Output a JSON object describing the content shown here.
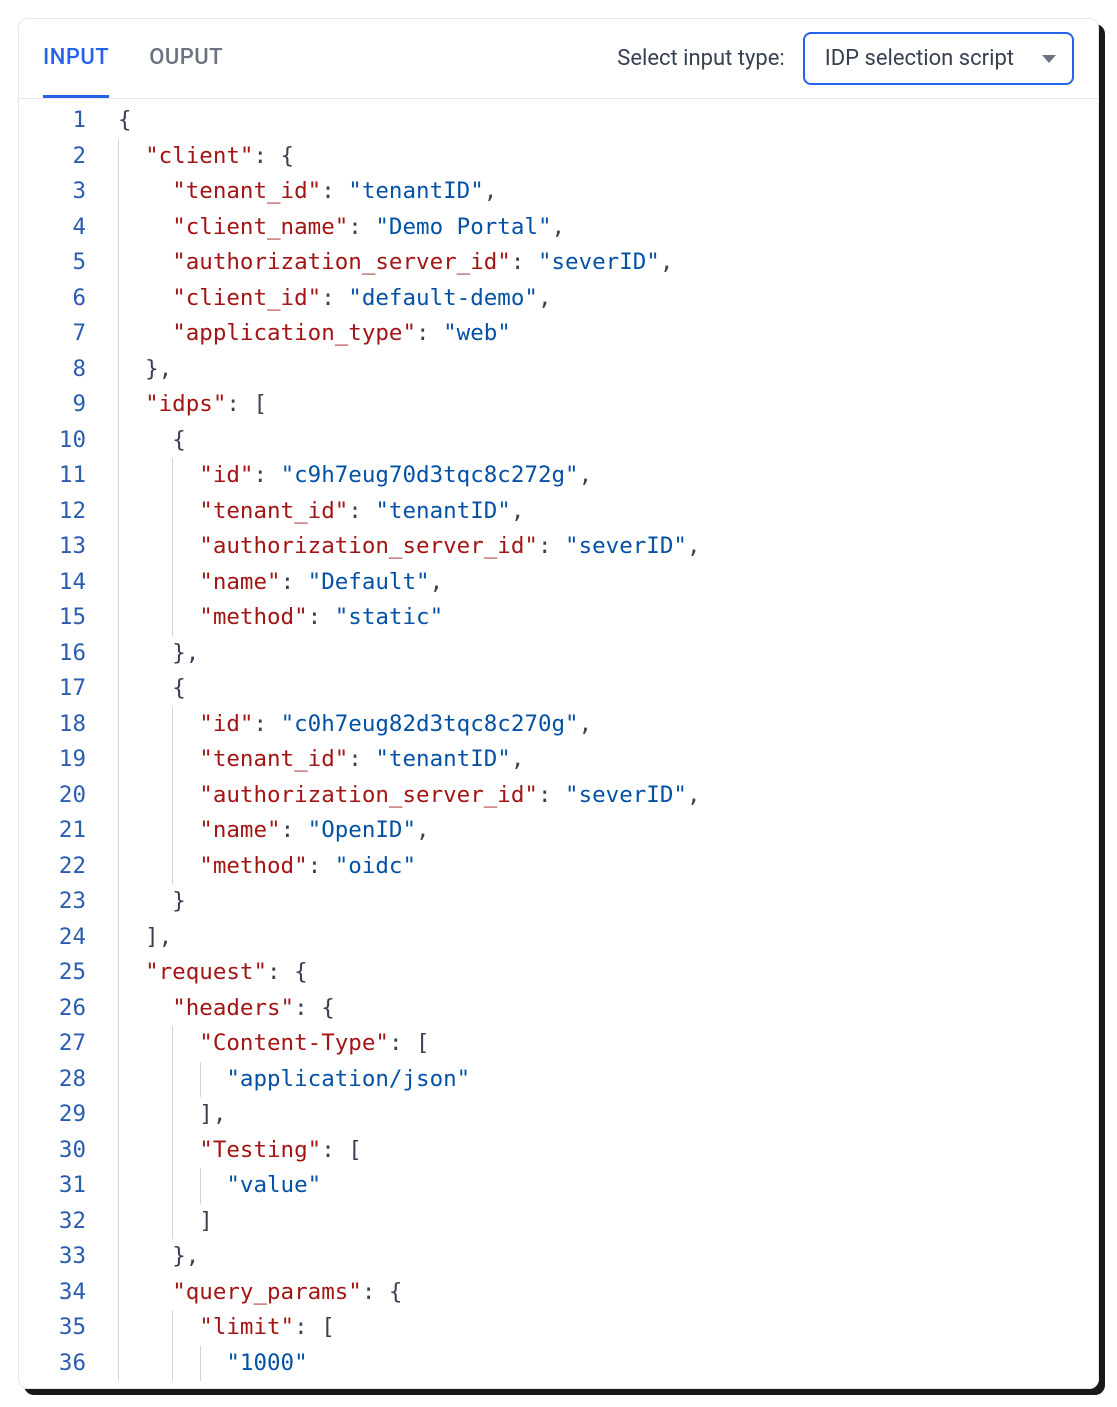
{
  "tabs": {
    "input": "INPUT",
    "output": "OUPUT"
  },
  "select": {
    "label": "Select input type:",
    "value": "IDP selection script"
  },
  "code_lines": [
    {
      "n": 1,
      "guides": [],
      "indent": "",
      "tokens": [
        [
          "p",
          "{"
        ]
      ]
    },
    {
      "n": 2,
      "guides": [
        0
      ],
      "indent": "  ",
      "tokens": [
        [
          "k",
          "\"client\""
        ],
        [
          "p",
          ": {"
        ]
      ]
    },
    {
      "n": 3,
      "guides": [
        0
      ],
      "indent": "    ",
      "tokens": [
        [
          "k",
          "\"tenant_id\""
        ],
        [
          "p",
          ": "
        ],
        [
          "s",
          "\"tenantID\""
        ],
        [
          "p",
          ","
        ]
      ]
    },
    {
      "n": 4,
      "guides": [
        0
      ],
      "indent": "    ",
      "tokens": [
        [
          "k",
          "\"client_name\""
        ],
        [
          "p",
          ": "
        ],
        [
          "s",
          "\"Demo Portal\""
        ],
        [
          "p",
          ","
        ]
      ]
    },
    {
      "n": 5,
      "guides": [
        0
      ],
      "indent": "    ",
      "tokens": [
        [
          "k",
          "\"authorization_server_id\""
        ],
        [
          "p",
          ": "
        ],
        [
          "s",
          "\"severID\""
        ],
        [
          "p",
          ","
        ]
      ]
    },
    {
      "n": 6,
      "guides": [
        0
      ],
      "indent": "    ",
      "tokens": [
        [
          "k",
          "\"client_id\""
        ],
        [
          "p",
          ": "
        ],
        [
          "s",
          "\"default-demo\""
        ],
        [
          "p",
          ","
        ]
      ]
    },
    {
      "n": 7,
      "guides": [
        0
      ],
      "indent": "    ",
      "tokens": [
        [
          "k",
          "\"application_type\""
        ],
        [
          "p",
          ": "
        ],
        [
          "s",
          "\"web\""
        ]
      ]
    },
    {
      "n": 8,
      "guides": [
        0
      ],
      "indent": "  ",
      "tokens": [
        [
          "p",
          "},"
        ]
      ]
    },
    {
      "n": 9,
      "guides": [
        0
      ],
      "indent": "  ",
      "tokens": [
        [
          "k",
          "\"idps\""
        ],
        [
          "p",
          ": ["
        ]
      ]
    },
    {
      "n": 10,
      "guides": [
        0
      ],
      "indent": "    ",
      "tokens": [
        [
          "p",
          "{"
        ]
      ]
    },
    {
      "n": 11,
      "guides": [
        0,
        4
      ],
      "indent": "      ",
      "tokens": [
        [
          "k",
          "\"id\""
        ],
        [
          "p",
          ": "
        ],
        [
          "s",
          "\"c9h7eug70d3tqc8c272g\""
        ],
        [
          "p",
          ","
        ]
      ]
    },
    {
      "n": 12,
      "guides": [
        0,
        4
      ],
      "indent": "      ",
      "tokens": [
        [
          "k",
          "\"tenant_id\""
        ],
        [
          "p",
          ": "
        ],
        [
          "s",
          "\"tenantID\""
        ],
        [
          "p",
          ","
        ]
      ]
    },
    {
      "n": 13,
      "guides": [
        0,
        4
      ],
      "indent": "      ",
      "tokens": [
        [
          "k",
          "\"authorization_server_id\""
        ],
        [
          "p",
          ": "
        ],
        [
          "s",
          "\"severID\""
        ],
        [
          "p",
          ","
        ]
      ]
    },
    {
      "n": 14,
      "guides": [
        0,
        4
      ],
      "indent": "      ",
      "tokens": [
        [
          "k",
          "\"name\""
        ],
        [
          "p",
          ": "
        ],
        [
          "s",
          "\"Default\""
        ],
        [
          "p",
          ","
        ]
      ]
    },
    {
      "n": 15,
      "guides": [
        0,
        4
      ],
      "indent": "      ",
      "tokens": [
        [
          "k",
          "\"method\""
        ],
        [
          "p",
          ": "
        ],
        [
          "s",
          "\"static\""
        ]
      ]
    },
    {
      "n": 16,
      "guides": [
        0
      ],
      "indent": "    ",
      "tokens": [
        [
          "p",
          "},"
        ]
      ]
    },
    {
      "n": 17,
      "guides": [
        0
      ],
      "indent": "    ",
      "tokens": [
        [
          "p",
          "{"
        ]
      ]
    },
    {
      "n": 18,
      "guides": [
        0,
        4
      ],
      "indent": "      ",
      "tokens": [
        [
          "k",
          "\"id\""
        ],
        [
          "p",
          ": "
        ],
        [
          "s",
          "\"c0h7eug82d3tqc8c270g\""
        ],
        [
          "p",
          ","
        ]
      ]
    },
    {
      "n": 19,
      "guides": [
        0,
        4
      ],
      "indent": "      ",
      "tokens": [
        [
          "k",
          "\"tenant_id\""
        ],
        [
          "p",
          ": "
        ],
        [
          "s",
          "\"tenantID\""
        ],
        [
          "p",
          ","
        ]
      ]
    },
    {
      "n": 20,
      "guides": [
        0,
        4
      ],
      "indent": "      ",
      "tokens": [
        [
          "k",
          "\"authorization_server_id\""
        ],
        [
          "p",
          ": "
        ],
        [
          "s",
          "\"severID\""
        ],
        [
          "p",
          ","
        ]
      ]
    },
    {
      "n": 21,
      "guides": [
        0,
        4
      ],
      "indent": "      ",
      "tokens": [
        [
          "k",
          "\"name\""
        ],
        [
          "p",
          ": "
        ],
        [
          "s",
          "\"OpenID\""
        ],
        [
          "p",
          ","
        ]
      ]
    },
    {
      "n": 22,
      "guides": [
        0,
        4
      ],
      "indent": "      ",
      "tokens": [
        [
          "k",
          "\"method\""
        ],
        [
          "p",
          ": "
        ],
        [
          "s",
          "\"oidc\""
        ]
      ]
    },
    {
      "n": 23,
      "guides": [
        0
      ],
      "indent": "    ",
      "tokens": [
        [
          "p",
          "}"
        ]
      ]
    },
    {
      "n": 24,
      "guides": [
        0
      ],
      "indent": "  ",
      "tokens": [
        [
          "p",
          "],"
        ]
      ]
    },
    {
      "n": 25,
      "guides": [
        0
      ],
      "indent": "  ",
      "tokens": [
        [
          "k",
          "\"request\""
        ],
        [
          "p",
          ": {"
        ]
      ]
    },
    {
      "n": 26,
      "guides": [
        0
      ],
      "indent": "    ",
      "tokens": [
        [
          "k",
          "\"headers\""
        ],
        [
          "p",
          ": {"
        ]
      ]
    },
    {
      "n": 27,
      "guides": [
        0,
        4
      ],
      "indent": "      ",
      "tokens": [
        [
          "k",
          "\"Content-Type\""
        ],
        [
          "p",
          ": ["
        ]
      ]
    },
    {
      "n": 28,
      "guides": [
        0,
        4,
        6
      ],
      "indent": "        ",
      "tokens": [
        [
          "s",
          "\"application/json\""
        ]
      ]
    },
    {
      "n": 29,
      "guides": [
        0,
        4
      ],
      "indent": "      ",
      "tokens": [
        [
          "p",
          "],"
        ]
      ]
    },
    {
      "n": 30,
      "guides": [
        0,
        4
      ],
      "indent": "      ",
      "tokens": [
        [
          "k",
          "\"Testing\""
        ],
        [
          "p",
          ": ["
        ]
      ]
    },
    {
      "n": 31,
      "guides": [
        0,
        4,
        6
      ],
      "indent": "        ",
      "tokens": [
        [
          "s",
          "\"value\""
        ]
      ]
    },
    {
      "n": 32,
      "guides": [
        0,
        4
      ],
      "indent": "      ",
      "tokens": [
        [
          "p",
          "]"
        ]
      ]
    },
    {
      "n": 33,
      "guides": [
        0
      ],
      "indent": "    ",
      "tokens": [
        [
          "p",
          "},"
        ]
      ]
    },
    {
      "n": 34,
      "guides": [
        0
      ],
      "indent": "    ",
      "tokens": [
        [
          "k",
          "\"query_params\""
        ],
        [
          "p",
          ": {"
        ]
      ]
    },
    {
      "n": 35,
      "guides": [
        0,
        4
      ],
      "indent": "      ",
      "tokens": [
        [
          "k",
          "\"limit\""
        ],
        [
          "p",
          ": ["
        ]
      ]
    },
    {
      "n": 36,
      "guides": [
        0,
        4,
        6
      ],
      "indent": "        ",
      "tokens": [
        [
          "s",
          "\"1000\""
        ]
      ]
    }
  ]
}
